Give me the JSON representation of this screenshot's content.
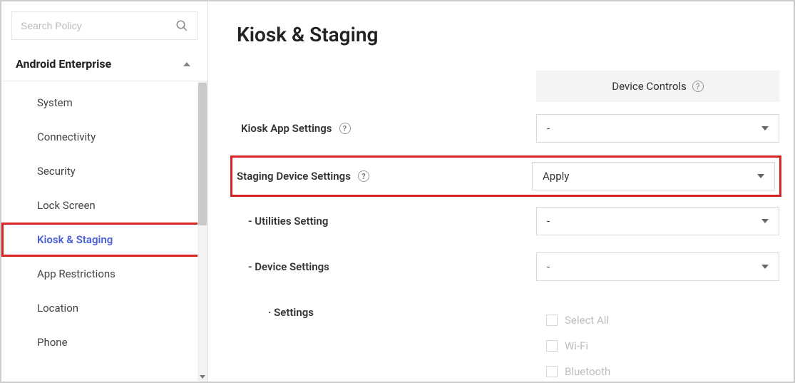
{
  "search": {
    "placeholder": "Search Policy"
  },
  "sidebar": {
    "section_title": "Android Enterprise",
    "items": [
      {
        "label": "System"
      },
      {
        "label": "Connectivity"
      },
      {
        "label": "Security"
      },
      {
        "label": "Lock Screen"
      },
      {
        "label": "Kiosk & Staging",
        "active": true,
        "highlight": true
      },
      {
        "label": "App Restrictions"
      },
      {
        "label": "Location"
      },
      {
        "label": "Phone"
      }
    ]
  },
  "main": {
    "title": "Kiosk & Staging",
    "column_header": "Device Controls",
    "rows": {
      "kiosk_app": {
        "label": "Kiosk App Settings",
        "value": "-"
      },
      "staging": {
        "label": "Staging Device Settings",
        "value": "Apply",
        "highlight": true
      },
      "utilities": {
        "label": "- Utilities Setting",
        "value": "-"
      },
      "device": {
        "label": "- Device Settings",
        "value": "-"
      },
      "settings_sub": {
        "label": "· Settings"
      }
    },
    "checks": [
      {
        "label": "Select All"
      },
      {
        "label": "Wi-Fi"
      },
      {
        "label": "Bluetooth"
      }
    ]
  }
}
